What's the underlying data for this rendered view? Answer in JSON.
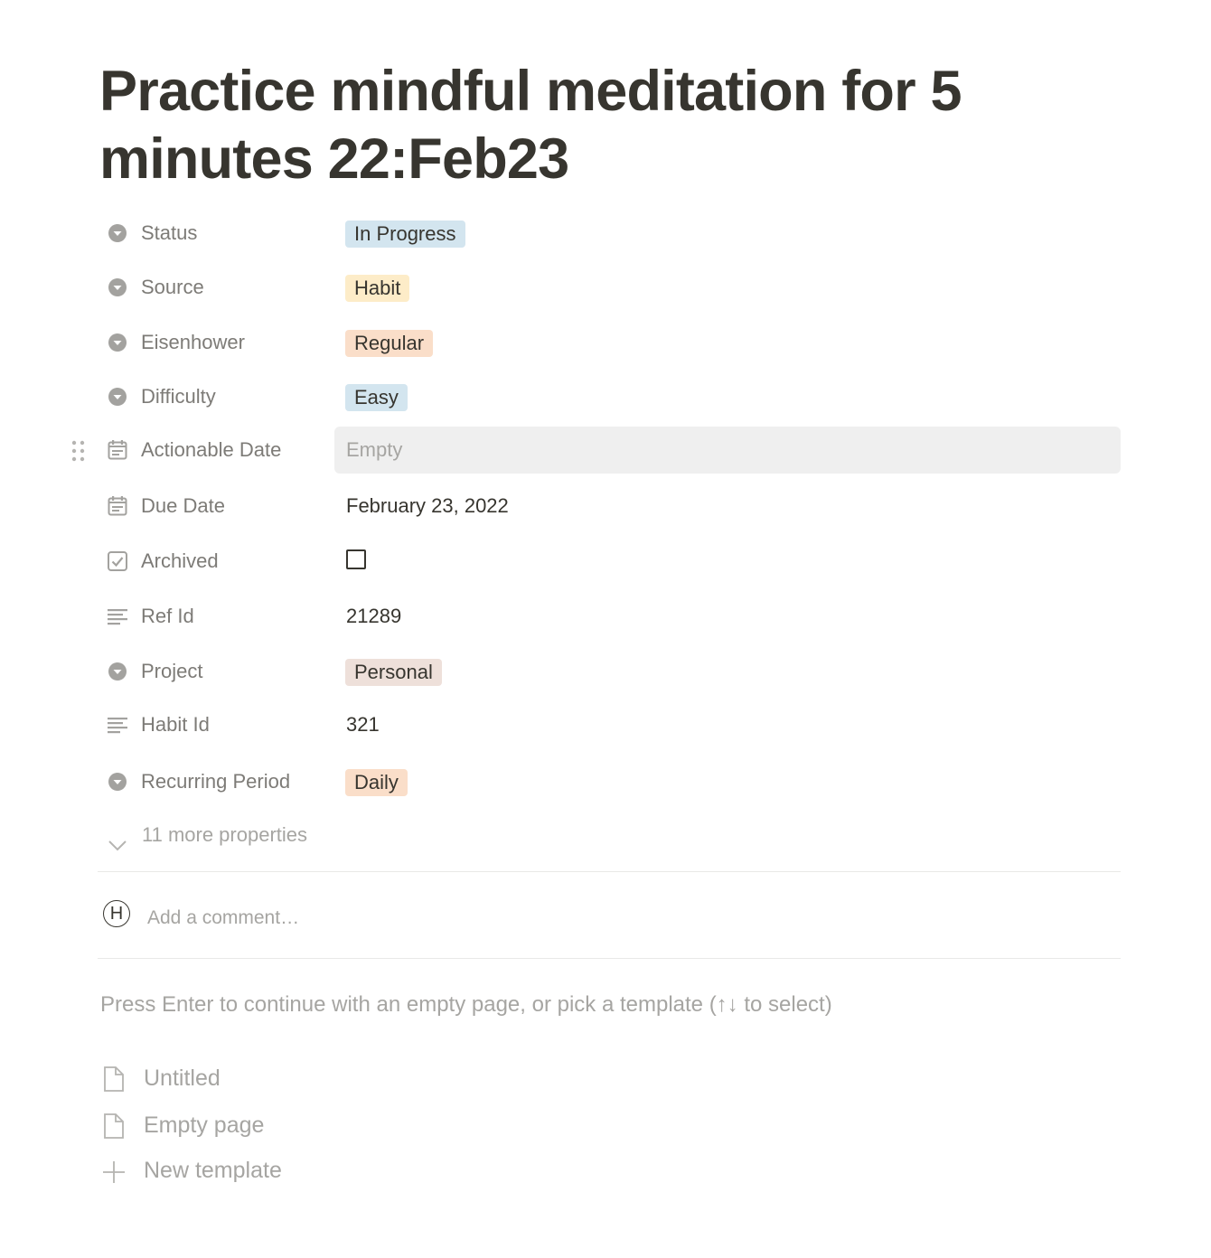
{
  "page": {
    "title": "Practice mindful meditation for 5 minutes 22:Feb23"
  },
  "properties": [
    {
      "label": "Status",
      "icon": "select-icon",
      "type": "tag",
      "value": "In Progress",
      "color": "#d3e5ef"
    },
    {
      "label": "Source",
      "icon": "select-icon",
      "type": "tag",
      "value": "Habit",
      "color": "#fdecc8"
    },
    {
      "label": "Eisenhower",
      "icon": "select-icon",
      "type": "tag",
      "value": "Regular",
      "color": "#fadec9"
    },
    {
      "label": "Difficulty",
      "icon": "select-icon",
      "type": "tag",
      "value": "Easy",
      "color": "#d3e5ef"
    },
    {
      "label": "Actionable Date",
      "icon": "calendar-icon",
      "type": "date",
      "value": "",
      "placeholder": "Empty"
    },
    {
      "label": "Due Date",
      "icon": "calendar-icon",
      "type": "date",
      "value": "February 23, 2022"
    },
    {
      "label": "Archived",
      "icon": "checkbox-icon",
      "type": "checkbox",
      "value": false
    },
    {
      "label": "Ref Id",
      "icon": "text-icon",
      "type": "text",
      "value": "21289"
    },
    {
      "label": "Project",
      "icon": "select-icon",
      "type": "tag",
      "value": "Personal",
      "color": "#eee0da"
    },
    {
      "label": "Habit Id",
      "icon": "text-icon",
      "type": "text",
      "value": "321"
    },
    {
      "label": "Recurring Period",
      "icon": "select-icon",
      "type": "tag",
      "value": "Daily",
      "color": "#fadec9"
    }
  ],
  "more_properties": {
    "label": "11 more properties"
  },
  "comment": {
    "avatar_initial": "H",
    "placeholder": "Add a comment…"
  },
  "template_hint": "Press Enter to continue with an empty page, or pick a template (↑↓ to select)",
  "templates": [
    {
      "label": "Untitled",
      "icon": "page-icon"
    },
    {
      "label": "Empty page",
      "icon": "page-icon"
    },
    {
      "label": "New template",
      "icon": "plus-icon"
    }
  ]
}
